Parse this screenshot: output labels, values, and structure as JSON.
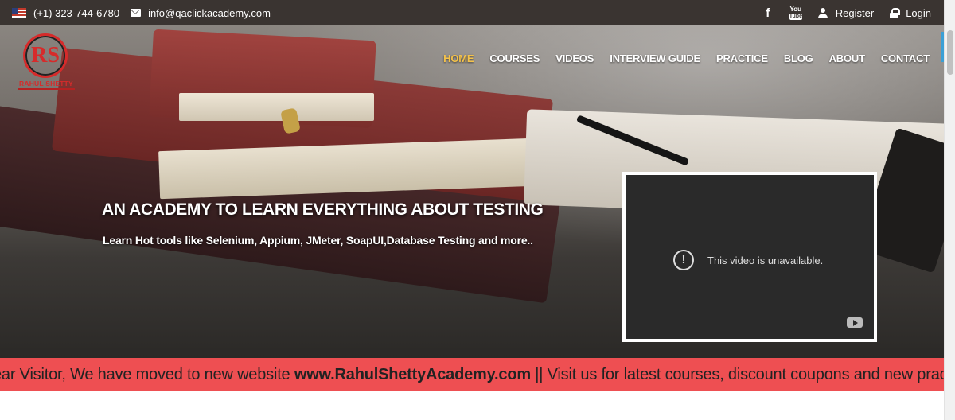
{
  "topbar": {
    "phone": "(+1) 323-744-6780",
    "email": "info@qaclickacademy.com",
    "facebook_glyph": "f",
    "youtube_top": "You",
    "youtube_bottom": "Tube",
    "register": "Register",
    "login": "Login"
  },
  "logo": {
    "monogram": "RS",
    "name": "RAHUL SHETTY"
  },
  "nav": {
    "items": [
      "HOME",
      "COURSES",
      "VIDEOS",
      "INTERVIEW GUIDE",
      "PRACTICE",
      "BLOG",
      "ABOUT",
      "CONTACT"
    ],
    "active": "HOME"
  },
  "hero": {
    "headline": "AN ACADEMY TO LEARN EVERYTHING ABOUT TESTING",
    "subtitle": "Learn Hot tools like Selenium, Appium, JMeter, SoapUI,Database Testing and more.."
  },
  "video": {
    "message": "This video is unavailable.",
    "alert_glyph": "!"
  },
  "marquee": {
    "prefix": "ear Visitor, We have moved to new website ",
    "link": "www.RahulShettyAcademy.com",
    "suffix": " || Visit us for latest courses, discount coupons and new pract"
  },
  "colors": {
    "accent": "#f4c24a",
    "marquee_bg": "#ee4f52",
    "topbar_bg": "#3a3431",
    "brand_red": "#d62b2b"
  },
  "icons": [
    "us-flag-icon",
    "mail-icon",
    "facebook-icon",
    "youtube-icon",
    "user-icon",
    "lock-icon",
    "alert-icon",
    "youtube-logo-icon"
  ]
}
